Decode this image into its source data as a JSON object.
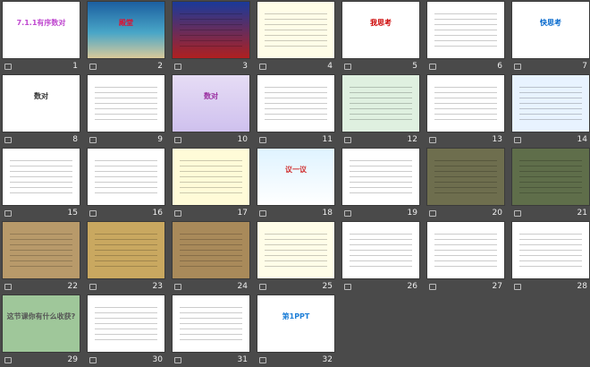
{
  "slides": [
    {
      "n": "1",
      "bg": "#ffffff",
      "title": "7.1.1有序数对",
      "color": "#c04ad0"
    },
    {
      "n": "2",
      "bg": "linear-gradient(#1c5fa0,#49a6c7 55%,#d9c99a)",
      "title": "殿堂",
      "color": "#e01030"
    },
    {
      "n": "3",
      "bg": "linear-gradient(#1a3a9a,#b02020)",
      "title": "",
      "color": "#fff"
    },
    {
      "n": "4",
      "bg": "#fffde8",
      "title": "",
      "color": "#333"
    },
    {
      "n": "5",
      "bg": "#ffffff",
      "title": "我思考",
      "color": "#c00"
    },
    {
      "n": "6",
      "bg": "#ffffff",
      "title": "",
      "color": "#333"
    },
    {
      "n": "7",
      "bg": "#ffffff",
      "title": "快思考",
      "color": "#06c"
    },
    {
      "n": "8",
      "bg": "#ffffff",
      "title": "数对",
      "color": "#333"
    },
    {
      "n": "9",
      "bg": "#ffffff",
      "title": "",
      "color": "#333"
    },
    {
      "n": "10",
      "bg": "linear-gradient(#e6dcf5,#cfc1ee)",
      "title": "数对",
      "color": "#9a2fa0"
    },
    {
      "n": "11",
      "bg": "#ffffff",
      "title": "",
      "color": "#333"
    },
    {
      "n": "12",
      "bg": "#dff0e0",
      "title": "",
      "color": "#333"
    },
    {
      "n": "13",
      "bg": "#ffffff",
      "title": "",
      "color": "#333"
    },
    {
      "n": "14",
      "bg": "#e8f3ff",
      "title": "",
      "color": "#333"
    },
    {
      "n": "15",
      "bg": "#ffffff",
      "title": "",
      "color": "#333"
    },
    {
      "n": "16",
      "bg": "#ffffff",
      "title": "",
      "color": "#333"
    },
    {
      "n": "17",
      "bg": "#fffbd8",
      "title": "",
      "color": "#333"
    },
    {
      "n": "18",
      "bg": "linear-gradient(#dff3ff,#ffffff)",
      "title": "议一议",
      "color": "#d03030"
    },
    {
      "n": "19",
      "bg": "#ffffff",
      "title": "",
      "color": "#333"
    },
    {
      "n": "20",
      "bg": "#6e6e4e",
      "title": "",
      "color": "#fff"
    },
    {
      "n": "21",
      "bg": "#5f6e4a",
      "title": "",
      "color": "#fff"
    },
    {
      "n": "22",
      "bg": "#b89a6a",
      "title": "",
      "color": "#333"
    },
    {
      "n": "23",
      "bg": "#c9a860",
      "title": "",
      "color": "#333"
    },
    {
      "n": "24",
      "bg": "#a98a5a",
      "title": "",
      "color": "#333"
    },
    {
      "n": "25",
      "bg": "#fffde8",
      "title": "",
      "color": "#333"
    },
    {
      "n": "26",
      "bg": "#ffffff",
      "title": "",
      "color": "#333"
    },
    {
      "n": "27",
      "bg": "#ffffff",
      "title": "",
      "color": "#333"
    },
    {
      "n": "28",
      "bg": "#ffffff",
      "title": "",
      "color": "#333"
    },
    {
      "n": "29",
      "bg": "#9fc79a",
      "title": "这节课你有什么收获?",
      "color": "#555"
    },
    {
      "n": "30",
      "bg": "#ffffff",
      "title": "",
      "color": "#333"
    },
    {
      "n": "31",
      "bg": "#ffffff",
      "title": "",
      "color": "#333"
    },
    {
      "n": "32",
      "bg": "#ffffff",
      "title": "第1PPT",
      "color": "#1e7fd8"
    }
  ]
}
